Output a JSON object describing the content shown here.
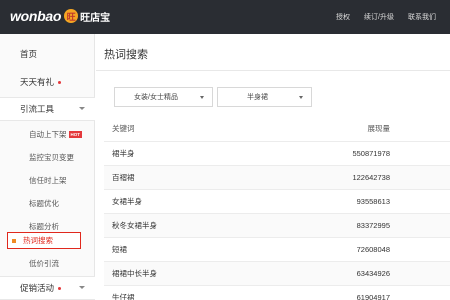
{
  "brand": {
    "name": "wonbao",
    "badge": "旺",
    "cn": "旺店宝"
  },
  "topnav": [
    "授权",
    "续订/升级",
    "联系我们"
  ],
  "sidebar": {
    "home": "首页",
    "daily_gift": "天天有礼",
    "traffic_tools": "引流工具",
    "sub_items": [
      "自动上下架",
      "监控宝贝变更",
      "信任时上架",
      "标题优化",
      "标题分析",
      "热词搜索",
      "低价引流"
    ],
    "hot_badge": "HOT",
    "promo": "促销活动"
  },
  "main": {
    "title": "热词搜索",
    "filter1": "女装/女士精品",
    "filter2": "半身裙",
    "table": {
      "headers": [
        "关键词",
        "展现量"
      ],
      "rows": [
        {
          "keyword": "裙半身",
          "count": "550871978"
        },
        {
          "keyword": "百褶裙",
          "count": "122642738"
        },
        {
          "keyword": "女裙半身",
          "count": "93558613"
        },
        {
          "keyword": "秋冬女裙半身",
          "count": "83372995"
        },
        {
          "keyword": "短裙",
          "count": "72608048"
        },
        {
          "keyword": "裙裙中长半身",
          "count": "63434926"
        },
        {
          "keyword": "牛仔裙",
          "count": "61904917"
        }
      ]
    }
  },
  "colors": {
    "topbar": "#2a2d33",
    "accent_red": "#e0281d",
    "active_square": "#f08a24",
    "logo_badge": "#f5a623"
  }
}
